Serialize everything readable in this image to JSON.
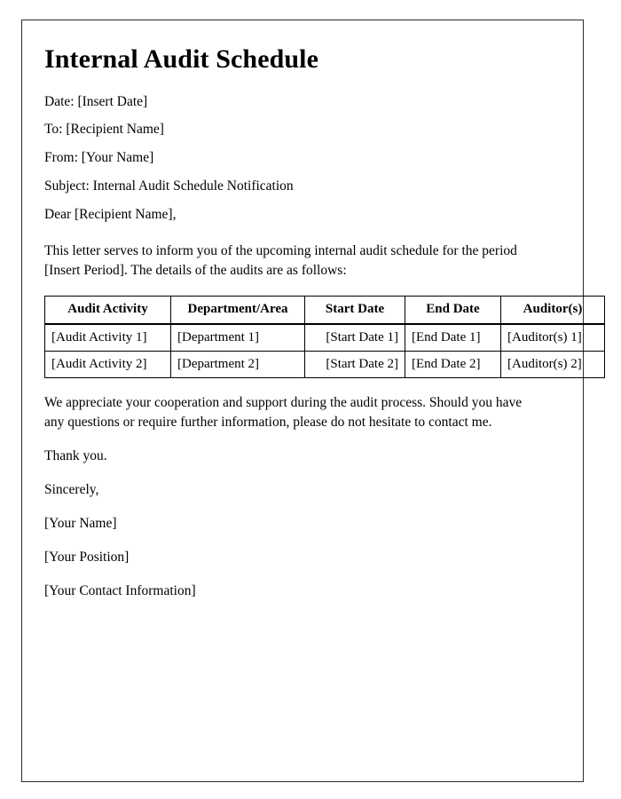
{
  "document": {
    "title": "Internal Audit Schedule",
    "header_fields": [
      {
        "label": "Date:",
        "value": "[Insert Date]",
        "full": "Date: [Insert Date]"
      },
      {
        "label": "To:",
        "value": "[Recipient Name]",
        "full": "To: [Recipient Name]"
      },
      {
        "label": "From:",
        "value": "[Your Name]",
        "full": "From: [Your Name]"
      },
      {
        "label": "Subject:",
        "value": "Internal Audit Schedule Notification",
        "full": "Subject: Internal Audit Schedule Notification"
      }
    ],
    "salutation": "Dear [Recipient Name],",
    "intro_paragraph": "This letter serves to inform you of the upcoming internal audit schedule for the period [Insert Period]. The details of the audits are as follows:",
    "closing_paragraph": "We appreciate your cooperation and support during the audit process. Should you have any questions or require further information, please do not hesitate to contact me.",
    "thanks": "Thank you.",
    "signoff": "Sincerely,",
    "signature_block": [
      "[Your Name]",
      "[Your Position]",
      "[Your Contact Information]"
    ]
  },
  "schedule_table": {
    "columns": [
      "Audit Activity",
      "Department/Area",
      "Start Date",
      "End Date",
      "Auditor(s)"
    ],
    "rows": [
      {
        "activity": "[Audit Activity 1]",
        "department": "[Department 1]",
        "start_date": "[Start Date 1]",
        "end_date": "[End Date 1]",
        "auditors": "[Auditor(s) 1]"
      },
      {
        "activity": "[Audit Activity 2]",
        "department": "[Department 2]",
        "start_date": "[Start Date 2]",
        "end_date": "[End Date 2]",
        "auditors": "[Auditor(s) 2]"
      }
    ]
  },
  "colors": {
    "page_background": "#ffffff",
    "page_border": "#2c2c2c",
    "text": "#000000",
    "table_border": "#000000"
  }
}
